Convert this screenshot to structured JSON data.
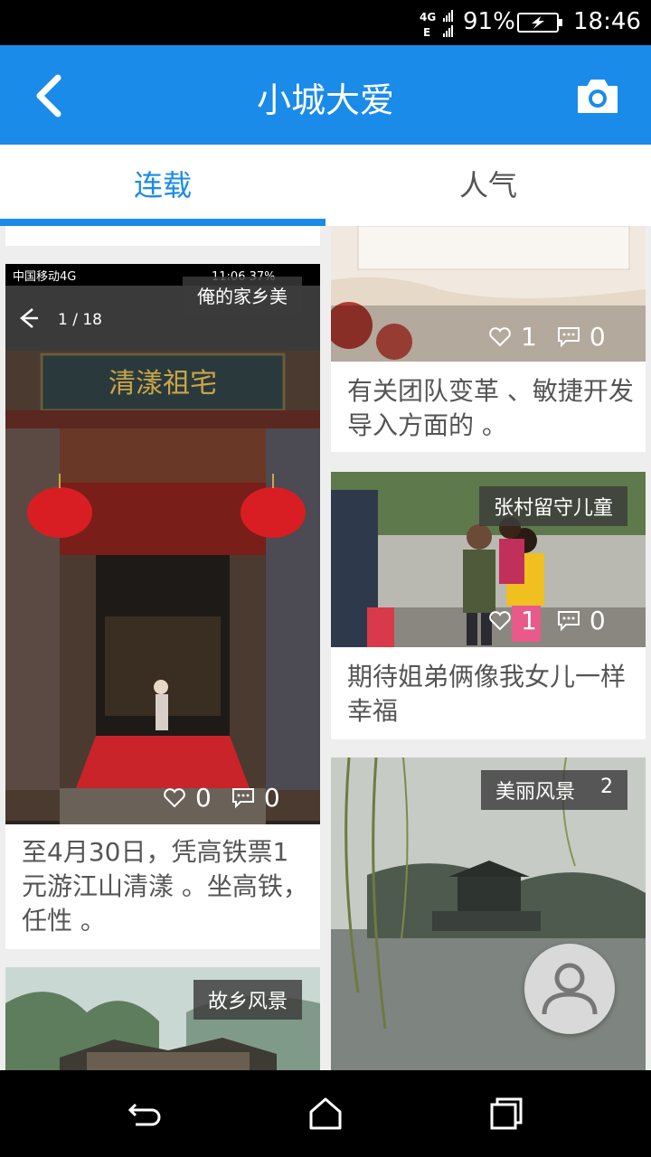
{
  "status_bar": {
    "network_label": "4G",
    "battery": "91%",
    "time": "18:46"
  },
  "app_bar": {
    "title": "小城大爱",
    "back_icon": "back-arrow-icon",
    "camera_icon": "camera-icon"
  },
  "tabs": [
    {
      "label": "连载",
      "active": true
    },
    {
      "label": "人气",
      "active": false
    }
  ],
  "colors": {
    "accent": "#1a8be8",
    "feed_bg": "#eeeeee"
  },
  "cards": {
    "hometown": {
      "inner_status_carrier": "中国移动4G",
      "inner_status_time": "11:06 37%",
      "inner_page": "1 / 18",
      "sign_text": "清漾祖宅",
      "tag": "俺的家乡美",
      "likes": "0",
      "comments": "0",
      "description": "至4月30日，凭高铁票1元游江山清漾 。坐高铁，任性 。"
    },
    "landscape_bottom": {
      "tag": "故乡风景"
    },
    "team": {
      "likes": "1",
      "comments": "0",
      "description": "有关团队变革 、敏捷开发导入方面的 。"
    },
    "children": {
      "tag": "张村留守儿童",
      "likes": "1",
      "comments": "0",
      "description": "期待姐弟俩像我女儿一样幸福"
    },
    "scenery": {
      "tag": "美丽风景",
      "tag_count": "2"
    }
  },
  "nav_bar": {
    "back": "nav-back-icon",
    "home": "nav-home-icon",
    "recents": "nav-recents-icon"
  },
  "fab": {
    "icon": "profile-icon"
  }
}
